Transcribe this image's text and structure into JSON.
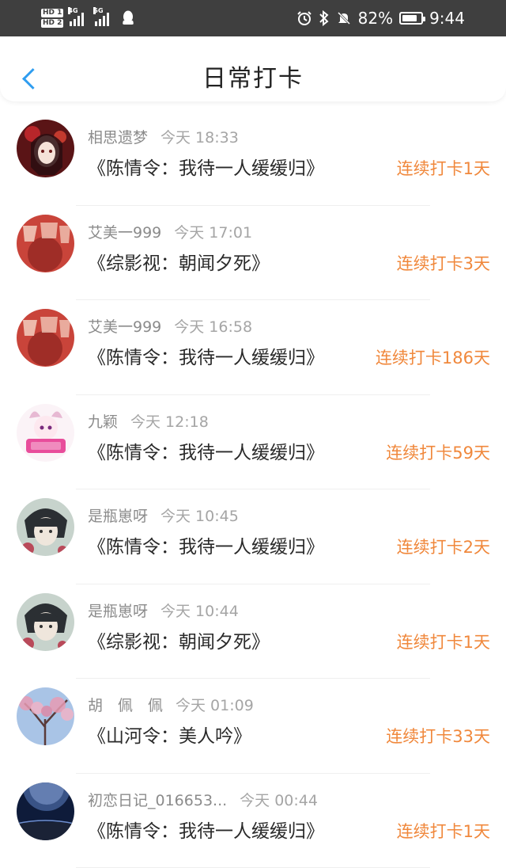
{
  "status_bar": {
    "left": {
      "hd1": "HD 1",
      "hd2": "HD 2",
      "net1": "4G",
      "net2": "5G"
    },
    "battery_percent": "82%",
    "battery_level": 0.82,
    "time": "9:44",
    "icons": [
      "alarm-icon",
      "bluetooth-icon",
      "mute-icon"
    ]
  },
  "header": {
    "title": "日常打卡",
    "back_icon": "chevron-left-icon",
    "accent": "#2f9df0"
  },
  "streak_color": "#f0883c",
  "entries": [
    {
      "user": "相思遗梦",
      "time": "今天 18:33",
      "book": "《陈情令：我待一人缓缓归》",
      "streak": "连续打卡1天"
    },
    {
      "user": "艾美一999",
      "time": "今天 17:01",
      "book": "《综影视：朝闻夕死》",
      "streak": "连续打卡3天"
    },
    {
      "user": "艾美一999",
      "time": "今天 16:58",
      "book": "《陈情令：我待一人缓缓归》",
      "streak": "连续打卡186天"
    },
    {
      "user": "九颖",
      "time": "今天 12:18",
      "book": "《陈情令：我待一人缓缓归》",
      "streak": "连续打卡59天"
    },
    {
      "user": "是瓶崽呀",
      "time": "今天 10:45",
      "book": "《陈情令：我待一人缓缓归》",
      "streak": "连续打卡2天"
    },
    {
      "user": "是瓶崽呀",
      "time": "今天 10:44",
      "book": "《综影视：朝闻夕死》",
      "streak": "连续打卡1天"
    },
    {
      "user": "胡　佩　佩",
      "time": "今天 01:09",
      "book": "《山河令：美人吟》",
      "streak": "连续打卡33天"
    },
    {
      "user": "初恋日记_016653...",
      "time": "今天 00:44",
      "book": "《陈情令：我待一人缓缓归》",
      "streak": "连续打卡1天"
    }
  ]
}
